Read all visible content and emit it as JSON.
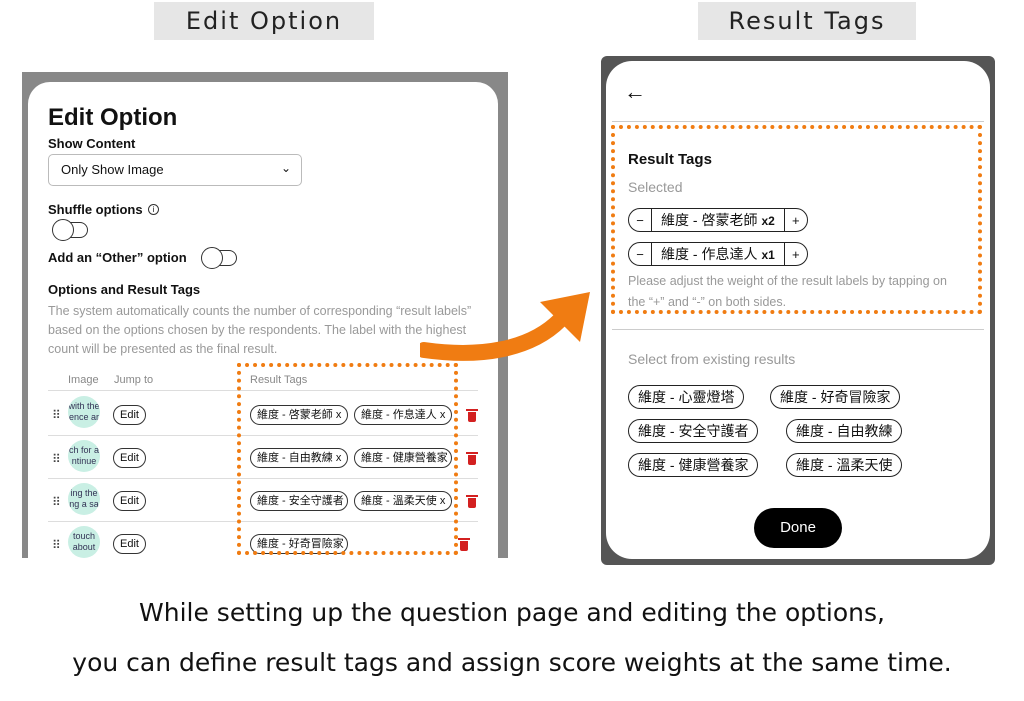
{
  "labels": {
    "edit_option": "Edit Option",
    "result_tags": "Result Tags"
  },
  "edit_option": {
    "title": "Edit Option",
    "show_content_label": "Show Content",
    "show_content_value": "Only Show Image",
    "shuffle_label": "Shuffle options",
    "other_label": "Add an “Other” option",
    "options_heading": "Options and Result Tags",
    "description": "The system automatically counts the number of corresponding “result labels” based on the options chosen by the respondents. The label with the highest count will be presented as the final result.",
    "columns": {
      "image": "Image",
      "jump_to": "Jump to",
      "result_tags": "Result Tags"
    },
    "rows": [
      {
        "thumb": "with the\nence ar",
        "edit": "Edit",
        "tags": [
          "維度 - 啓蒙老師 x",
          "維度 - 作息達人 x"
        ]
      },
      {
        "thumb": "ch for a\nntinue",
        "edit": "Edit",
        "tags": [
          "維度 - 自由教練 x",
          "維度 - 健康營養家"
        ]
      },
      {
        "thumb": "ing the\nng a sa",
        "edit": "Edit",
        "tags": [
          "維度 - 安全守護者",
          "維度 - 溫柔天使 x"
        ]
      },
      {
        "thumb": "touch\nabout",
        "edit": "Edit",
        "tags": [
          "維度 - 好奇冒險家"
        ]
      }
    ]
  },
  "result_tags": {
    "back_icon": "←",
    "title": "Result Tags",
    "selected_label": "Selected",
    "selected": [
      {
        "minus": "−",
        "name": "維度 - 啓蒙老師",
        "weight": "x2",
        "plus": "+"
      },
      {
        "minus": "−",
        "name": "維度 - 作息達人",
        "weight": "x1",
        "plus": "+"
      }
    ],
    "hint": "Please adjust the weight of the result labels by tapping on the “+” and “-” on both sides.",
    "existing_label": "Select from existing results",
    "existing": [
      "維度 - 心靈燈塔",
      "維度 - 好奇冒險家",
      "維度 - 安全守護者",
      "維度 - 自由教練",
      "維度 - 健康營養家",
      "維度 - 溫柔天使"
    ],
    "done": "Done"
  },
  "caption": {
    "line1": "While setting up the question page and editing the options,",
    "line2": "you can define result tags and assign score weights at the same time."
  },
  "colors": {
    "accent_orange": "#f07c12",
    "trash_red": "#d32020",
    "thumb_mint": "#c9efe4"
  }
}
